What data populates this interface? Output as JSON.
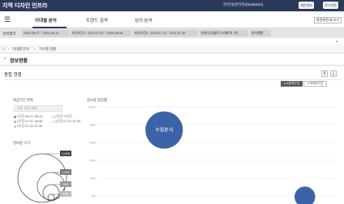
{
  "header": {
    "title": "지역 디자인 인프라",
    "user": "관리자(관리자@kdadmin)",
    "buttons": [
      "개인정보",
      "로그아웃"
    ]
  },
  "nav": {
    "tabs": [
      "이대별 분석",
      "트렌드 검색",
      "심의 분석"
    ],
    "active_tab": 0,
    "rotate_button": "화면회전/표 보기"
  },
  "filters": {
    "label": "검색필터",
    "chips": [
      "2024-06-07 ~ 2024-06-13",
      "비교기간1 : 2024-07-01 ~ 2024-08-08",
      "비교기간2 : 2024-07-24 ~ 2024-07-30",
      "커뮤니티/블로그/카페 외 7개",
      "지자체별"
    ]
  },
  "breadcrumb": [
    "이대별 분석",
    "직수별 현황"
  ],
  "section": {
    "title": "정보현황"
  },
  "panel": {
    "title": "종합 현황",
    "icons": [
      "info-icon",
      "download-icon"
    ],
    "toggles": [
      "1-2검색구간",
      "1-3비교구간"
    ],
    "compare_label": "대상기간 변화",
    "compare_placeholder": "기준 설정 해제",
    "periods": [
      {
        "label": "1구간 06.07~06.13",
        "color": "#8a8a8a"
      },
      {
        "label": "2구간 07.01~08.08",
        "color": "#b0b0b0"
      },
      {
        "label": "3구간 07.24~07.30",
        "color": "#c8c8c8"
      },
      {
        "label": "2구간~3구간",
        "color": "#d8d8d8"
      },
      {
        "label": "4구간 07.24~07.30",
        "color": "#e0e0e0"
      }
    ],
    "size_label": "정보량 크기",
    "legend_values": [
      "1,628",
      "1,000",
      "500",
      "100"
    ],
    "chart_title": "정보량 점감률"
  },
  "chart_data": {
    "type": "scatter",
    "y_ticks": [
      "100%",
      "80%",
      "60%",
      "40%",
      "20%",
      "0%"
    ],
    "ylim": [
      0,
      100
    ],
    "points": [
      {
        "label": "수질분석",
        "x": 0.28,
        "y": 74,
        "size": 1628,
        "color": "#3b63a8"
      },
      {
        "label": "",
        "x": 0.87,
        "y": -1,
        "size": 500,
        "color": "#3b63a8"
      }
    ]
  },
  "colors": {
    "header": "#2b3a5a",
    "bubble": "#3b63a8"
  }
}
